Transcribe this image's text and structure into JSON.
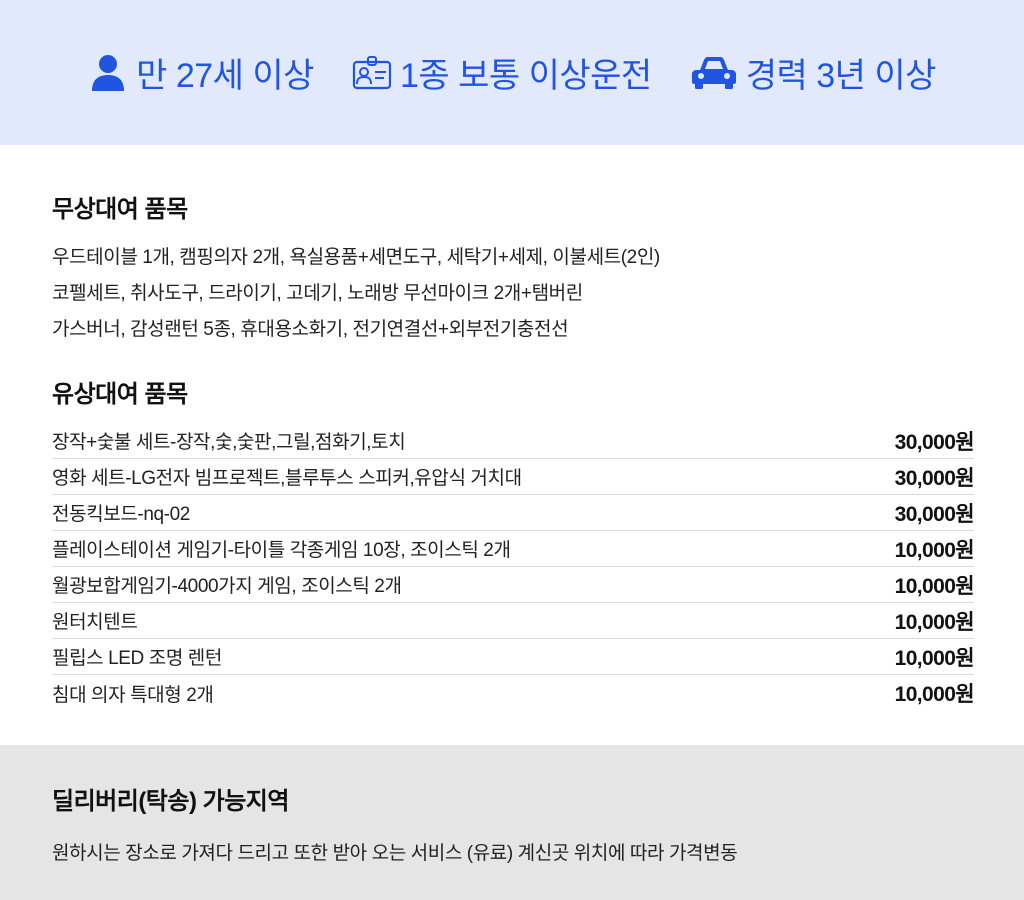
{
  "requirements": [
    {
      "icon": "person-icon",
      "label": "만 27세 이상"
    },
    {
      "icon": "license-card-icon",
      "label": "1종 보통 이상운전"
    },
    {
      "icon": "car-icon",
      "label": "경력 3년 이상"
    }
  ],
  "free_rental": {
    "title": "무상대여 품목",
    "lines": [
      "우드테이블 1개, 캠핑의자 2개, 욕실용품+세면도구, 세탁기+세제, 이불세트(2인)",
      "코펠세트, 취사도구, 드라이기, 고데기, 노래방 무선마이크 2개+탬버린",
      "가스버너, 감성랜턴 5종, 휴대용소화기, 전기연결선+외부전기충전선"
    ]
  },
  "paid_rental": {
    "title": "유상대여 품목",
    "items": [
      {
        "name": "장작+숯불 세트-장작,숯,숯판,그릴,점화기,토치",
        "price": "30,000원"
      },
      {
        "name": "영화 세트-LG전자 빔프로젝트,블루투스 스피커,유압식 거치대",
        "price": "30,000원"
      },
      {
        "name": "전동킥보드-nq-02",
        "price": "30,000원"
      },
      {
        "name": "플레이스테이션 게임기-타이틀 각종게임 10장, 조이스틱 2개",
        "price": "10,000원"
      },
      {
        "name": "월광보합게임기-4000가지 게임, 조이스틱 2개",
        "price": "10,000원"
      },
      {
        "name": "원터치텐트",
        "price": "10,000원"
      },
      {
        "name": "필립스 LED 조명 렌턴",
        "price": "10,000원"
      },
      {
        "name": "침대 의자 특대형 2개",
        "price": "10,000원"
      }
    ]
  },
  "delivery": {
    "title": "딜리버리(탁송) 가능지역",
    "description": "원하시는 장소로 가져다 드리고 또한 받아 오는 서비스 (유료) 계신곳 위치에 따라 가격변동"
  },
  "colors": {
    "accent": "#1f55e0",
    "header_bg": "#e3e9fc",
    "footer_bg": "#e5e5e5"
  }
}
